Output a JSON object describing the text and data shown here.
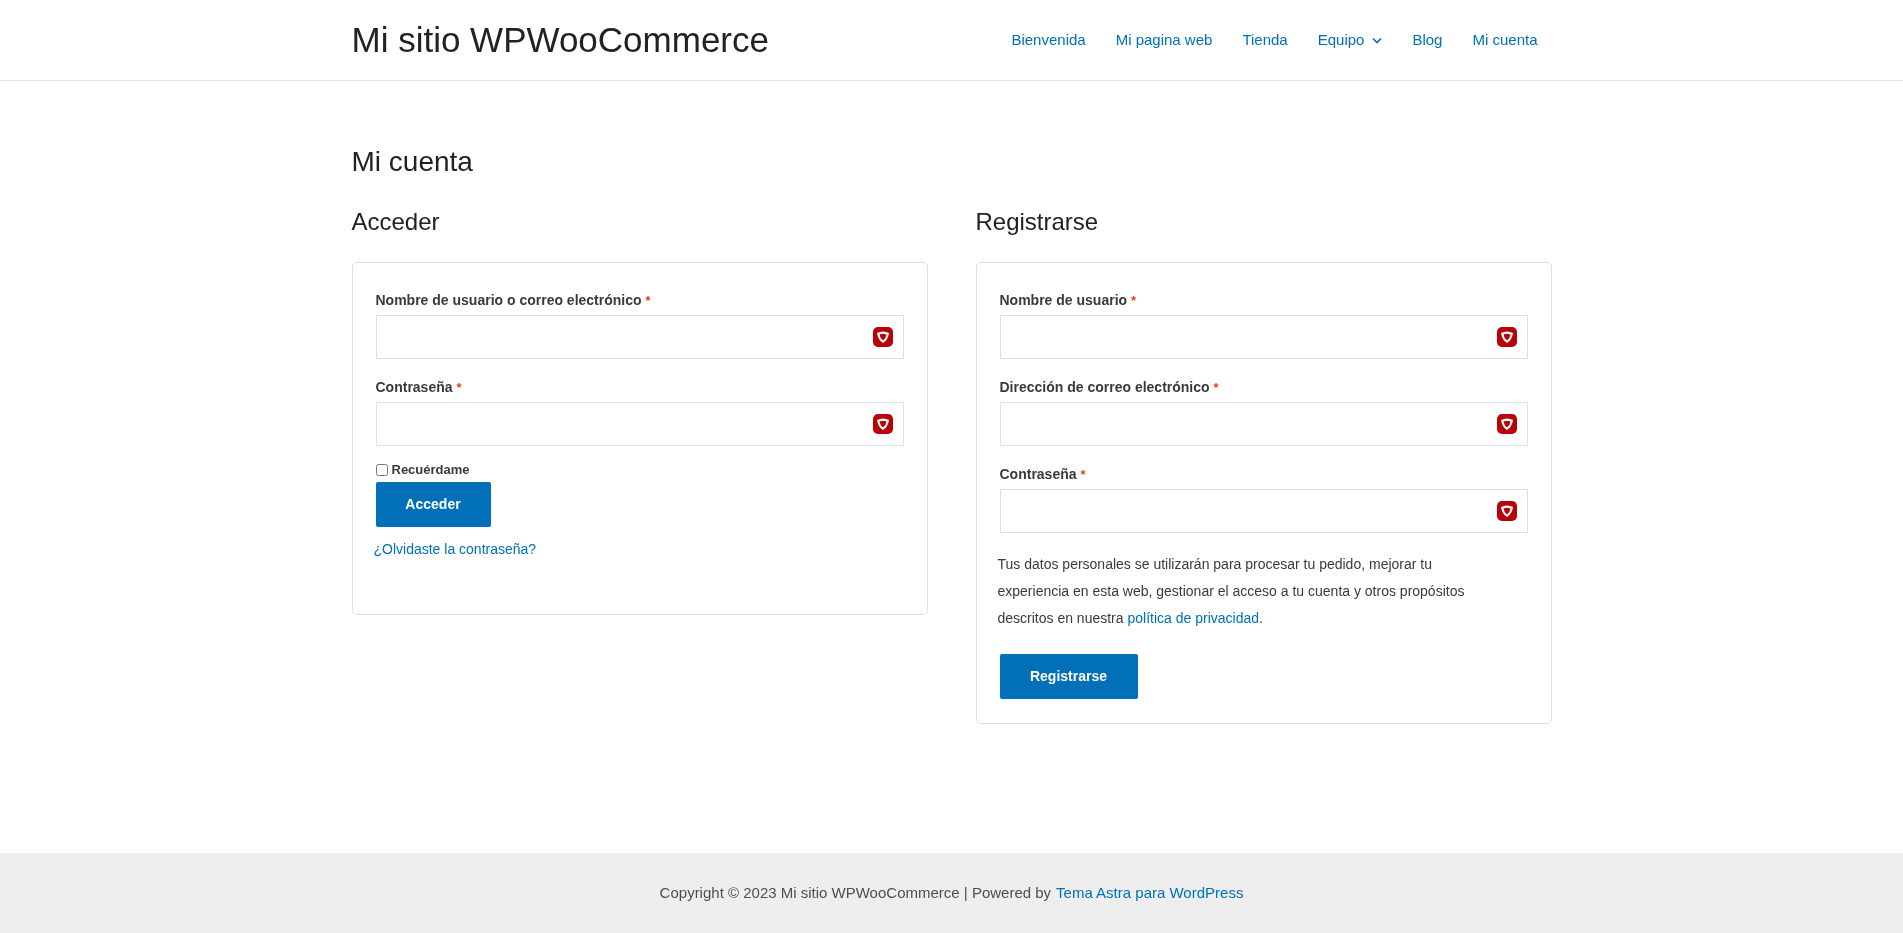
{
  "header": {
    "site_title": "Mi sitio WPWooCommerce",
    "nav": [
      {
        "label": "Bienvenida",
        "has_dropdown": false
      },
      {
        "label": "Mi pagina web",
        "has_dropdown": false
      },
      {
        "label": "Tienda",
        "has_dropdown": false
      },
      {
        "label": "Equipo",
        "has_dropdown": true
      },
      {
        "label": "Blog",
        "has_dropdown": false
      },
      {
        "label": "Mi cuenta",
        "has_dropdown": false
      }
    ]
  },
  "page_title": "Mi cuenta",
  "login": {
    "heading": "Acceder",
    "fields": [
      {
        "label": "Nombre de usuario o correo electrónico",
        "required_mark": "*"
      },
      {
        "label": "Contraseña",
        "required_mark": "*"
      }
    ],
    "remember": {
      "label": "Recuérdame",
      "checked": false
    },
    "button": "Acceder",
    "lost_password": "¿Olvidaste la contraseña?"
  },
  "register": {
    "heading": "Registrarse",
    "fields": [
      {
        "label": "Nombre de usuario",
        "required_mark": "*"
      },
      {
        "label": "Dirección de correo electrónico",
        "required_mark": "*"
      },
      {
        "label": "Contraseña",
        "required_mark": "*"
      }
    ],
    "privacy_text": "Tus datos personales se utilizarán para procesar tu pedido, mejorar tu experiencia en esta web, gestionar el acceso a tu cuenta y otros propósitos descritos en nuestra",
    "privacy_link": "política de privacidad",
    "privacy_end": ".",
    "button": "Registrarse"
  },
  "footer": {
    "text": "Copyright © 2023 Mi sitio WPWooCommerce | Powered by",
    "link": "Tema Astra para WordPress"
  }
}
